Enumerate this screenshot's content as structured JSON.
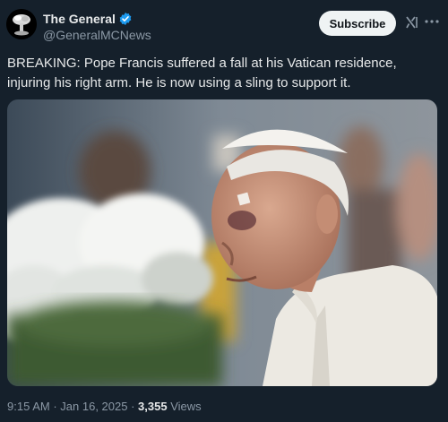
{
  "tweet": {
    "author_name": "The General",
    "author_handle": "@GeneralMCNews",
    "verified_color": "#1d9bf0",
    "subscribe_label": "Subscribe",
    "grok_icon": "grok-icon",
    "more_icon": "more-options-icon",
    "text": "BREAKING: Pope Francis suffered a fall at his Vatican residence, injuring his right arm. He is now using a sling to support it.",
    "time": "9:15 AM",
    "date": "Jan 16, 2025",
    "views_count": "3,355",
    "views_label": "Views"
  },
  "colors": {
    "background": "#15202b",
    "text_primary": "#e7e9ea",
    "text_secondary": "#8b98a5",
    "subscribe_bg": "#eff3f4"
  }
}
